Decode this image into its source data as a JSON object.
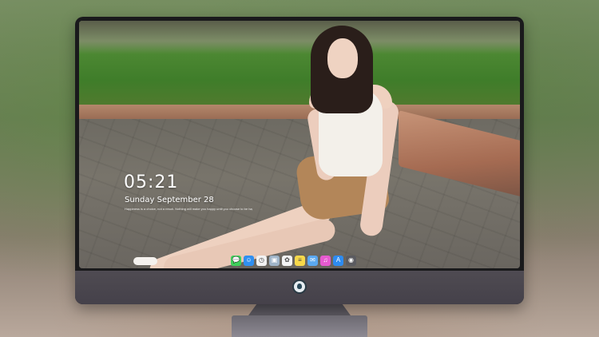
{
  "lockscreen": {
    "time": "05:21",
    "date": "Sunday September 28",
    "quote": "Happiness is a choice, not a result. Nothing will make you happy until you choose to be happy."
  },
  "dock": {
    "icons": [
      {
        "name": "messages-icon",
        "glyph": "💬",
        "color": "#3ecf5a"
      },
      {
        "name": "finder-icon",
        "glyph": "☺",
        "color": "#2f8ff0"
      },
      {
        "name": "clock-icon",
        "glyph": "◷",
        "color": "#f2f2f2"
      },
      {
        "name": "preview-icon",
        "glyph": "▣",
        "color": "#9fb4c8"
      },
      {
        "name": "photos-icon",
        "glyph": "✿",
        "color": "#f4f4f4"
      },
      {
        "name": "notes-icon",
        "glyph": "≡",
        "color": "#f7d84a"
      },
      {
        "name": "mail-icon",
        "glyph": "✉",
        "color": "#5aa8f0"
      },
      {
        "name": "itunes-icon",
        "glyph": "♫",
        "color": "#e65ad0"
      },
      {
        "name": "app-store-icon",
        "glyph": "A",
        "color": "#2d8bf0"
      },
      {
        "name": "camera-icon",
        "glyph": "◉",
        "color": "#5b5b60"
      }
    ]
  },
  "colors": {
    "bezel": "#1a1a1c",
    "chin": "#4a464e",
    "stand": "#7a777f"
  }
}
